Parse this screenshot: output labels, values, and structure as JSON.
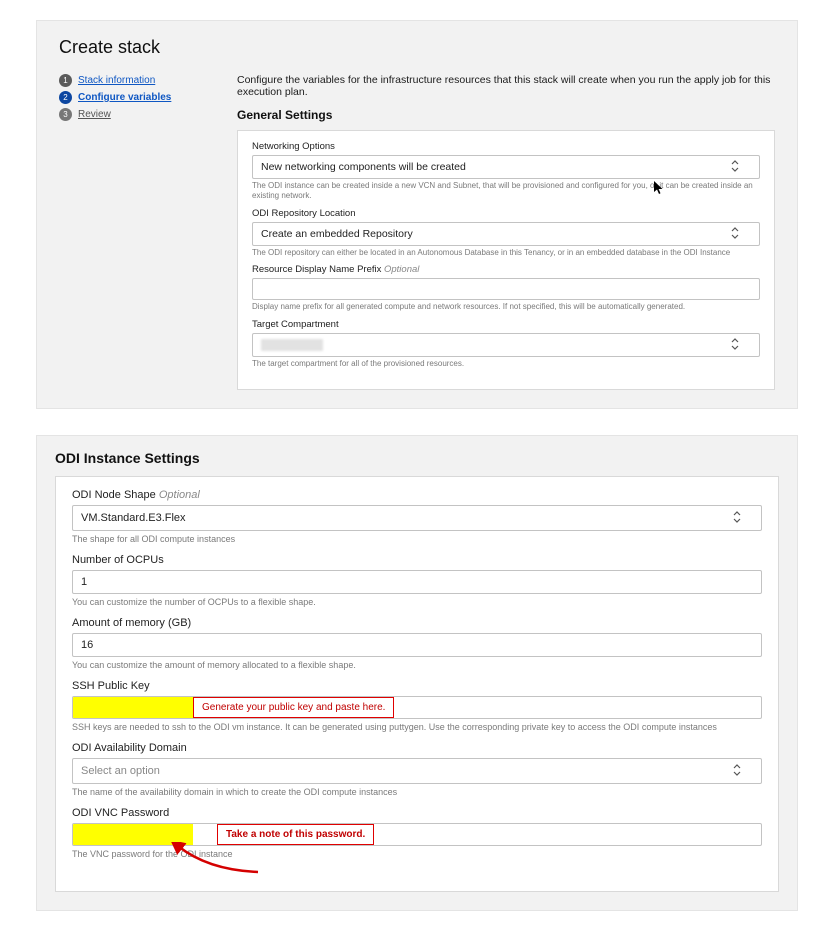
{
  "page": {
    "title": "Create stack"
  },
  "steps": {
    "s1": "Stack information",
    "s2": "Configure variables",
    "s3": "Review"
  },
  "intro": "Configure the variables for the infrastructure resources that this stack will create when you run the apply job for this execution plan.",
  "general": {
    "title": "General Settings",
    "networking": {
      "label": "Networking Options",
      "value": "New networking components will be created",
      "help": "The ODI instance can be created inside a new VCN and Subnet, that will be provisioned and configured for you, or it can be created inside an existing network."
    },
    "repo": {
      "label": "ODI Repository Location",
      "value": "Create an embedded Repository",
      "help": "The ODI repository can either be located in an Autonomous Database in this Tenancy, or in an embedded database in the ODI Instance"
    },
    "prefix": {
      "label": "Resource Display Name Prefix",
      "opt": "Optional",
      "help": "Display name prefix for all generated compute and network resources. If not specified, this will be automatically generated."
    },
    "target": {
      "label": "Target Compartment",
      "help": "The target compartment for all of the provisioned resources."
    }
  },
  "odi": {
    "title": "ODI Instance Settings",
    "shape": {
      "label": "ODI Node Shape",
      "opt": "Optional",
      "value": "VM.Standard.E3.Flex",
      "help": "The shape for all ODI compute instances"
    },
    "ocpus": {
      "label": "Number of OCPUs",
      "value": "1",
      "help": "You can customize the number of OCPUs to a flexible shape."
    },
    "mem": {
      "label": "Amount of memory (GB)",
      "value": "16",
      "help": "You can customize the amount of memory allocated to a flexible shape."
    },
    "ssh": {
      "label": "SSH Public Key",
      "callout": "Generate your public key and paste here.",
      "help": "SSH keys are needed to ssh to the ODI vm instance. It can be generated using puttygen. Use the corresponding private key to access the ODI compute instances"
    },
    "ad": {
      "label": "ODI Availability Domain",
      "value": "Select an option",
      "help": "The name of the availability domain in which to create the ODI compute instances"
    },
    "vnc": {
      "label": "ODI VNC Password",
      "callout": "Take a note of this password.",
      "help": "The VNC password for the ODI instance"
    }
  }
}
